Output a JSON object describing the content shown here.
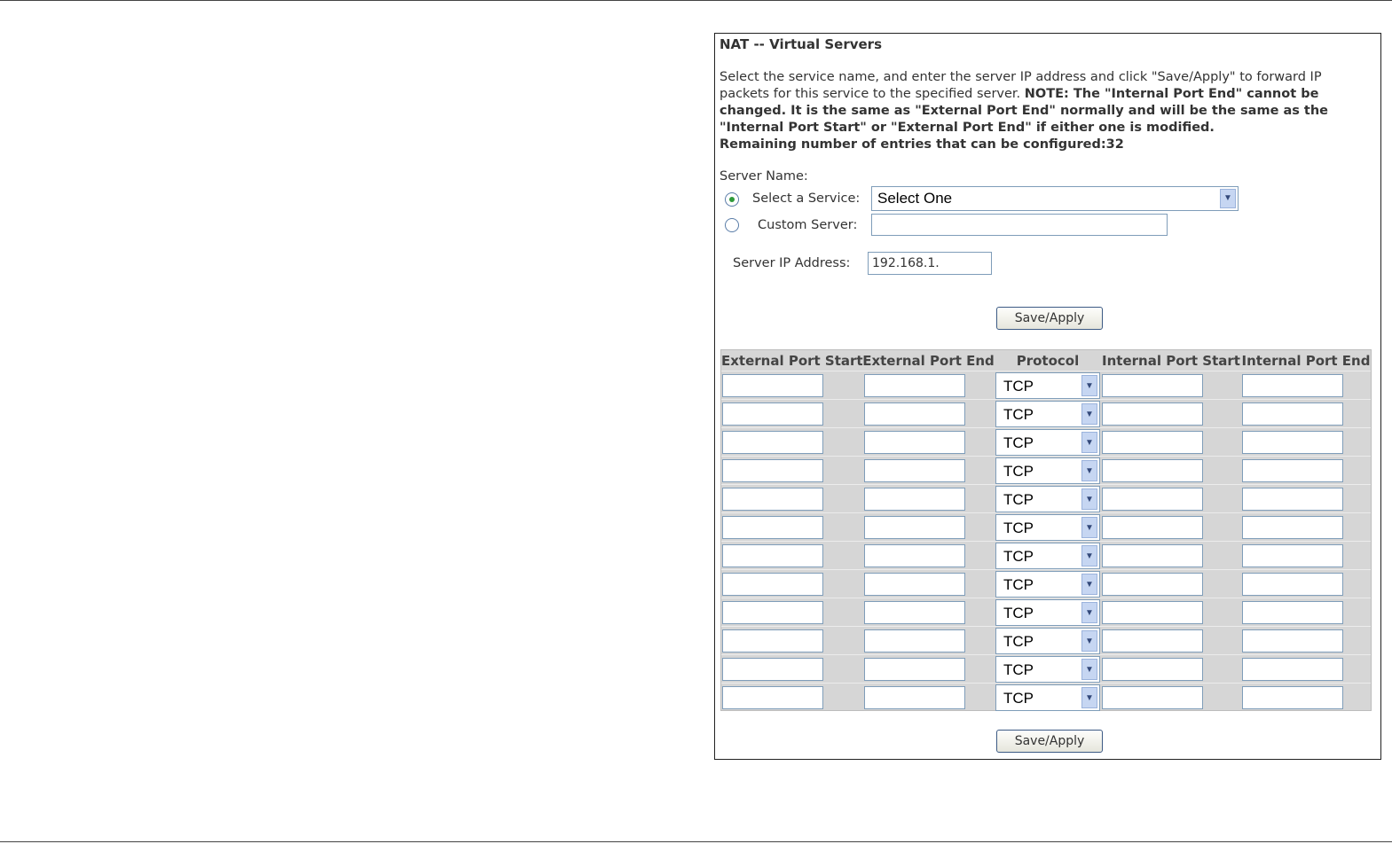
{
  "page": {
    "title": "NAT -- Virtual Servers",
    "description_normal": "Select the service name, and enter the server IP address and click \"Save/Apply\" to forward IP packets for this service to the specified server. ",
    "description_bold": "NOTE: The \"Internal Port End\" cannot be changed. It is the same as \"External Port End\" normally and will be the same as the \"Internal Port Start\" or \"External Port End\" if either one is modified.",
    "remaining": "Remaining number of entries that can be configured:32"
  },
  "form": {
    "server_name_label": "Server Name:",
    "select_service_label": "Select a Service:",
    "select_service_value": "Select One",
    "select_service_checked": true,
    "custom_server_label": "Custom Server:",
    "custom_server_value": "",
    "server_ip_label": "Server IP Address:",
    "server_ip_value": "192.168.1."
  },
  "buttons": {
    "save_apply_top": "Save/Apply",
    "save_apply_bottom": "Save/Apply"
  },
  "table": {
    "headers": [
      "External Port Start",
      "External Port End",
      "Protocol",
      "Internal Port Start",
      "Internal Port End"
    ],
    "rows": [
      {
        "ext_start": "",
        "ext_end": "",
        "protocol": "TCP",
        "int_start": "",
        "int_end": ""
      },
      {
        "ext_start": "",
        "ext_end": "",
        "protocol": "TCP",
        "int_start": "",
        "int_end": ""
      },
      {
        "ext_start": "",
        "ext_end": "",
        "protocol": "TCP",
        "int_start": "",
        "int_end": ""
      },
      {
        "ext_start": "",
        "ext_end": "",
        "protocol": "TCP",
        "int_start": "",
        "int_end": ""
      },
      {
        "ext_start": "",
        "ext_end": "",
        "protocol": "TCP",
        "int_start": "",
        "int_end": ""
      },
      {
        "ext_start": "",
        "ext_end": "",
        "protocol": "TCP",
        "int_start": "",
        "int_end": ""
      },
      {
        "ext_start": "",
        "ext_end": "",
        "protocol": "TCP",
        "int_start": "",
        "int_end": ""
      },
      {
        "ext_start": "",
        "ext_end": "",
        "protocol": "TCP",
        "int_start": "",
        "int_end": ""
      },
      {
        "ext_start": "",
        "ext_end": "",
        "protocol": "TCP",
        "int_start": "",
        "int_end": ""
      },
      {
        "ext_start": "",
        "ext_end": "",
        "protocol": "TCP",
        "int_start": "",
        "int_end": ""
      },
      {
        "ext_start": "",
        "ext_end": "",
        "protocol": "TCP",
        "int_start": "",
        "int_end": ""
      },
      {
        "ext_start": "",
        "ext_end": "",
        "protocol": "TCP",
        "int_start": "",
        "int_end": ""
      }
    ]
  },
  "icons": {
    "dropdown": "chevron-down-icon",
    "radio": "radio-button-icon"
  }
}
